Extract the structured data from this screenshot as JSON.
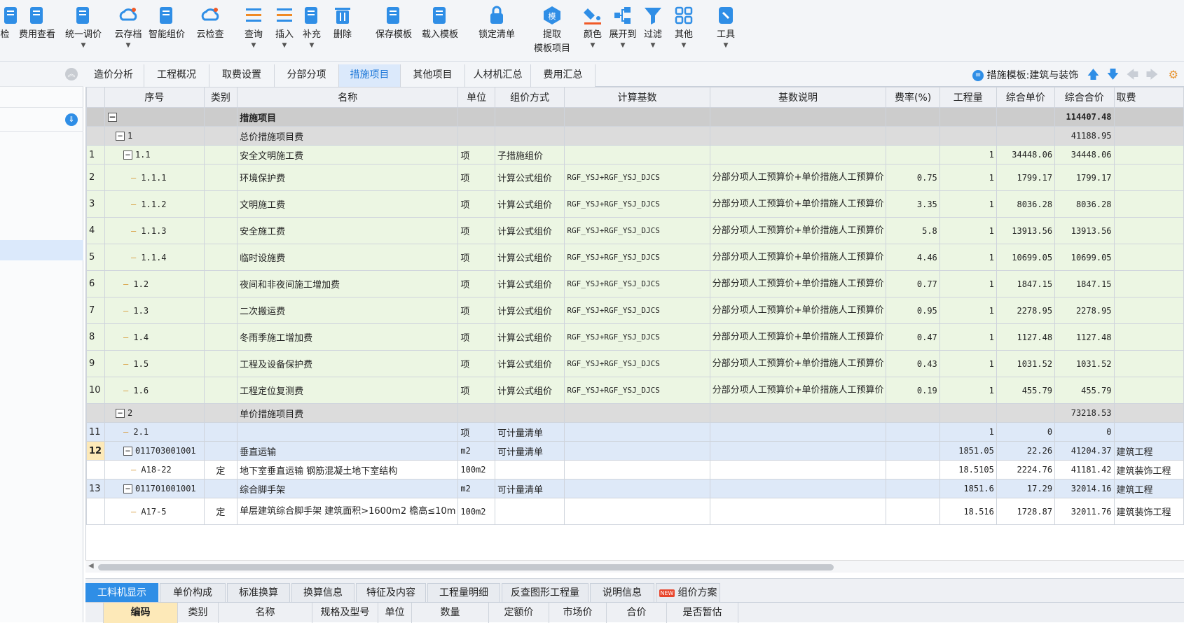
{
  "toolbar": {
    "items": [
      {
        "label": "检",
        "icon": "check-icon"
      },
      {
        "label": "费用查看",
        "icon": "fee-view-icon"
      },
      {
        "label": "统一调价",
        "icon": "price-adjust-icon"
      },
      {
        "label": "云存档",
        "icon": "cloud-archive-icon"
      },
      {
        "label": "智能组价",
        "icon": "smart-pricing-icon"
      },
      {
        "label": "云检查",
        "icon": "cloud-check-icon"
      },
      {
        "label": "查询",
        "icon": "query-icon"
      },
      {
        "label": "插入",
        "icon": "insert-icon"
      },
      {
        "label": "补充",
        "icon": "supplement-icon"
      },
      {
        "label": "删除",
        "icon": "delete-icon"
      },
      {
        "label": "保存模板",
        "icon": "save-template-icon"
      },
      {
        "label": "载入模板",
        "icon": "load-template-icon"
      },
      {
        "label": "锁定清单",
        "icon": "lock-icon"
      },
      {
        "label": "提取",
        "label2": "模板项目",
        "icon": "extract-template-icon"
      },
      {
        "label": "颜色",
        "icon": "color-icon"
      },
      {
        "label": "展开到",
        "icon": "expand-to-icon"
      },
      {
        "label": "过滤",
        "icon": "filter-icon"
      },
      {
        "label": "其他",
        "icon": "other-icon"
      },
      {
        "label": "工具",
        "icon": "tools-icon"
      }
    ]
  },
  "tabs": [
    "造价分析",
    "工程概况",
    "取费设置",
    "分部分项",
    "措施项目",
    "其他项目",
    "人材机汇总",
    "费用汇总"
  ],
  "active_tab": "措施项目",
  "template_label": "措施模板:建筑与装饰",
  "columns": [
    "序号",
    "类别",
    "名称",
    "单位",
    "组价方式",
    "计算基数",
    "基数说明",
    "费率(%)",
    "工程量",
    "综合单价",
    "综合合价",
    "取费"
  ],
  "rows": [
    {
      "rn": "",
      "code": "措施项目",
      "type": "",
      "name": "措施项目",
      "unit": "",
      "method": "",
      "base": "",
      "desc": "",
      "rate": "",
      "qty": "",
      "price": "",
      "total": "114407.48",
      "fee": "",
      "style": "top",
      "level": 0,
      "box": "−"
    },
    {
      "rn": "",
      "code": "1",
      "type": "",
      "name": "总价措施项目费",
      "unit": "",
      "method": "",
      "base": "",
      "desc": "",
      "rate": "",
      "qty": "",
      "price": "",
      "total": "41188.95",
      "fee": "",
      "style": "grey",
      "level": 1,
      "box": "−"
    },
    {
      "rn": "1",
      "code": "1.1",
      "type": "",
      "name": "安全文明施工费",
      "unit": "项",
      "method": "子措施组价",
      "base": "",
      "desc": "",
      "rate": "",
      "qty": "1",
      "price": "34448.06",
      "total": "34448.06",
      "fee": "",
      "style": "green",
      "level": 2,
      "box": "−"
    },
    {
      "rn": "2",
      "code": "1.1.1",
      "type": "",
      "name": "环境保护费",
      "unit": "项",
      "method": "计算公式组价",
      "base": "RGF_YSJ+RGF_YSJ_DJCS",
      "desc": "分部分项人工预算价+单价措施人工预算价",
      "rate": "0.75",
      "qty": "1",
      "price": "1799.17",
      "total": "1799.17",
      "fee": "",
      "style": "green",
      "level": 3,
      "box": ""
    },
    {
      "rn": "3",
      "code": "1.1.2",
      "type": "",
      "name": "文明施工费",
      "unit": "项",
      "method": "计算公式组价",
      "base": "RGF_YSJ+RGF_YSJ_DJCS",
      "desc": "分部分项人工预算价+单价措施人工预算价",
      "rate": "3.35",
      "qty": "1",
      "price": "8036.28",
      "total": "8036.28",
      "fee": "",
      "style": "green",
      "level": 3,
      "box": ""
    },
    {
      "rn": "4",
      "code": "1.1.3",
      "type": "",
      "name": "安全施工费",
      "unit": "项",
      "method": "计算公式组价",
      "base": "RGF_YSJ+RGF_YSJ_DJCS",
      "desc": "分部分项人工预算价+单价措施人工预算价",
      "rate": "5.8",
      "qty": "1",
      "price": "13913.56",
      "total": "13913.56",
      "fee": "",
      "style": "green",
      "level": 3,
      "box": ""
    },
    {
      "rn": "5",
      "code": "1.1.4",
      "type": "",
      "name": "临时设施费",
      "unit": "项",
      "method": "计算公式组价",
      "base": "RGF_YSJ+RGF_YSJ_DJCS",
      "desc": "分部分项人工预算价+单价措施人工预算价",
      "rate": "4.46",
      "qty": "1",
      "price": "10699.05",
      "total": "10699.05",
      "fee": "",
      "style": "green",
      "level": 3,
      "box": ""
    },
    {
      "rn": "6",
      "code": "1.2",
      "type": "",
      "name": "夜间和非夜间施工增加费",
      "unit": "项",
      "method": "计算公式组价",
      "base": "RGF_YSJ+RGF_YSJ_DJCS",
      "desc": "分部分项人工预算价+单价措施人工预算价",
      "rate": "0.77",
      "qty": "1",
      "price": "1847.15",
      "total": "1847.15",
      "fee": "",
      "style": "green",
      "level": 2,
      "box": ""
    },
    {
      "rn": "7",
      "code": "1.3",
      "type": "",
      "name": "二次搬运费",
      "unit": "项",
      "method": "计算公式组价",
      "base": "RGF_YSJ+RGF_YSJ_DJCS",
      "desc": "分部分项人工预算价+单价措施人工预算价",
      "rate": "0.95",
      "qty": "1",
      "price": "2278.95",
      "total": "2278.95",
      "fee": "",
      "style": "green",
      "level": 2,
      "box": ""
    },
    {
      "rn": "8",
      "code": "1.4",
      "type": "",
      "name": "冬雨季施工增加费",
      "unit": "项",
      "method": "计算公式组价",
      "base": "RGF_YSJ+RGF_YSJ_DJCS",
      "desc": "分部分项人工预算价+单价措施人工预算价",
      "rate": "0.47",
      "qty": "1",
      "price": "1127.48",
      "total": "1127.48",
      "fee": "",
      "style": "green",
      "level": 2,
      "box": ""
    },
    {
      "rn": "9",
      "code": "1.5",
      "type": "",
      "name": "工程及设备保护费",
      "unit": "项",
      "method": "计算公式组价",
      "base": "RGF_YSJ+RGF_YSJ_DJCS",
      "desc": "分部分项人工预算价+单价措施人工预算价",
      "rate": "0.43",
      "qty": "1",
      "price": "1031.52",
      "total": "1031.52",
      "fee": "",
      "style": "green",
      "level": 2,
      "box": ""
    },
    {
      "rn": "10",
      "code": "1.6",
      "type": "",
      "name": "工程定位复测费",
      "unit": "项",
      "method": "计算公式组价",
      "base": "RGF_YSJ+RGF_YSJ_DJCS",
      "desc": "分部分项人工预算价+单价措施人工预算价",
      "rate": "0.19",
      "qty": "1",
      "price": "455.79",
      "total": "455.79",
      "fee": "",
      "style": "green",
      "level": 2,
      "box": ""
    },
    {
      "rn": "",
      "code": "2",
      "type": "",
      "name": "单价措施项目费",
      "unit": "",
      "method": "",
      "base": "",
      "desc": "",
      "rate": "",
      "qty": "",
      "price": "",
      "total": "73218.53",
      "fee": "",
      "style": "grey",
      "level": 1,
      "box": "−"
    },
    {
      "rn": "11",
      "code": "2.1",
      "type": "",
      "name": "",
      "unit": "项",
      "method": "可计量清单",
      "base": "",
      "desc": "",
      "rate": "",
      "qty": "1",
      "price": "0",
      "total": "0",
      "fee": "",
      "style": "blue",
      "level": 2,
      "box": ""
    },
    {
      "rn": "12",
      "code": "011703001001",
      "type": "",
      "name": "垂直运输",
      "unit": "m2",
      "method": "可计量清单",
      "base": "",
      "desc": "",
      "rate": "",
      "qty": "1851.05",
      "price": "22.26",
      "total": "41204.37",
      "fee": "建筑工程",
      "style": "blue",
      "level": 2,
      "box": "−",
      "selected": true
    },
    {
      "rn": "",
      "code": "A18-22",
      "type": "定",
      "name": "地下室垂直运输 钢筋混凝土地下室结构",
      "unit": "100m2",
      "method": "",
      "base": "",
      "desc": "",
      "rate": "",
      "qty": "18.5105",
      "price": "2224.76",
      "total": "41181.42",
      "fee": "建筑装饰工程",
      "style": "white",
      "level": 3,
      "box": ""
    },
    {
      "rn": "13",
      "code": "011701001001",
      "type": "",
      "name": "综合脚手架",
      "unit": "m2",
      "method": "可计量清单",
      "base": "",
      "desc": "",
      "rate": "",
      "qty": "1851.6",
      "price": "17.29",
      "total": "32014.16",
      "fee": "建筑工程",
      "style": "blue",
      "level": 2,
      "box": "−"
    },
    {
      "rn": "",
      "code": "A17-5",
      "type": "定",
      "name": "单层建筑综合脚手架 建筑面积>1600m2 檐高≤10m",
      "unit": "100m2",
      "method": "",
      "base": "",
      "desc": "",
      "rate": "",
      "qty": "18.516",
      "price": "1728.87",
      "total": "32011.76",
      "fee": "建筑装饰工程",
      "style": "white",
      "level": 3,
      "box": ""
    }
  ],
  "bottom_tabs": [
    "工料机显示",
    "单价构成",
    "标准换算",
    "换算信息",
    "特征及内容",
    "工程量明细",
    "反查图形工程量",
    "说明信息",
    "组价方案"
  ],
  "bottom_active": "工料机显示",
  "bottom_new_badge": "NEW",
  "bottom_columns": [
    "编码",
    "类别",
    "名称",
    "规格及型号",
    "单位",
    "数量",
    "定额价",
    "市场价",
    "合价",
    "是否暂估"
  ],
  "colors": {
    "accent": "#1e78d8",
    "selected_header": "#fde9b8",
    "green_row": "#ecf6e3",
    "blue_row": "#dee9f8",
    "grey_row": "#dcdcdc"
  }
}
